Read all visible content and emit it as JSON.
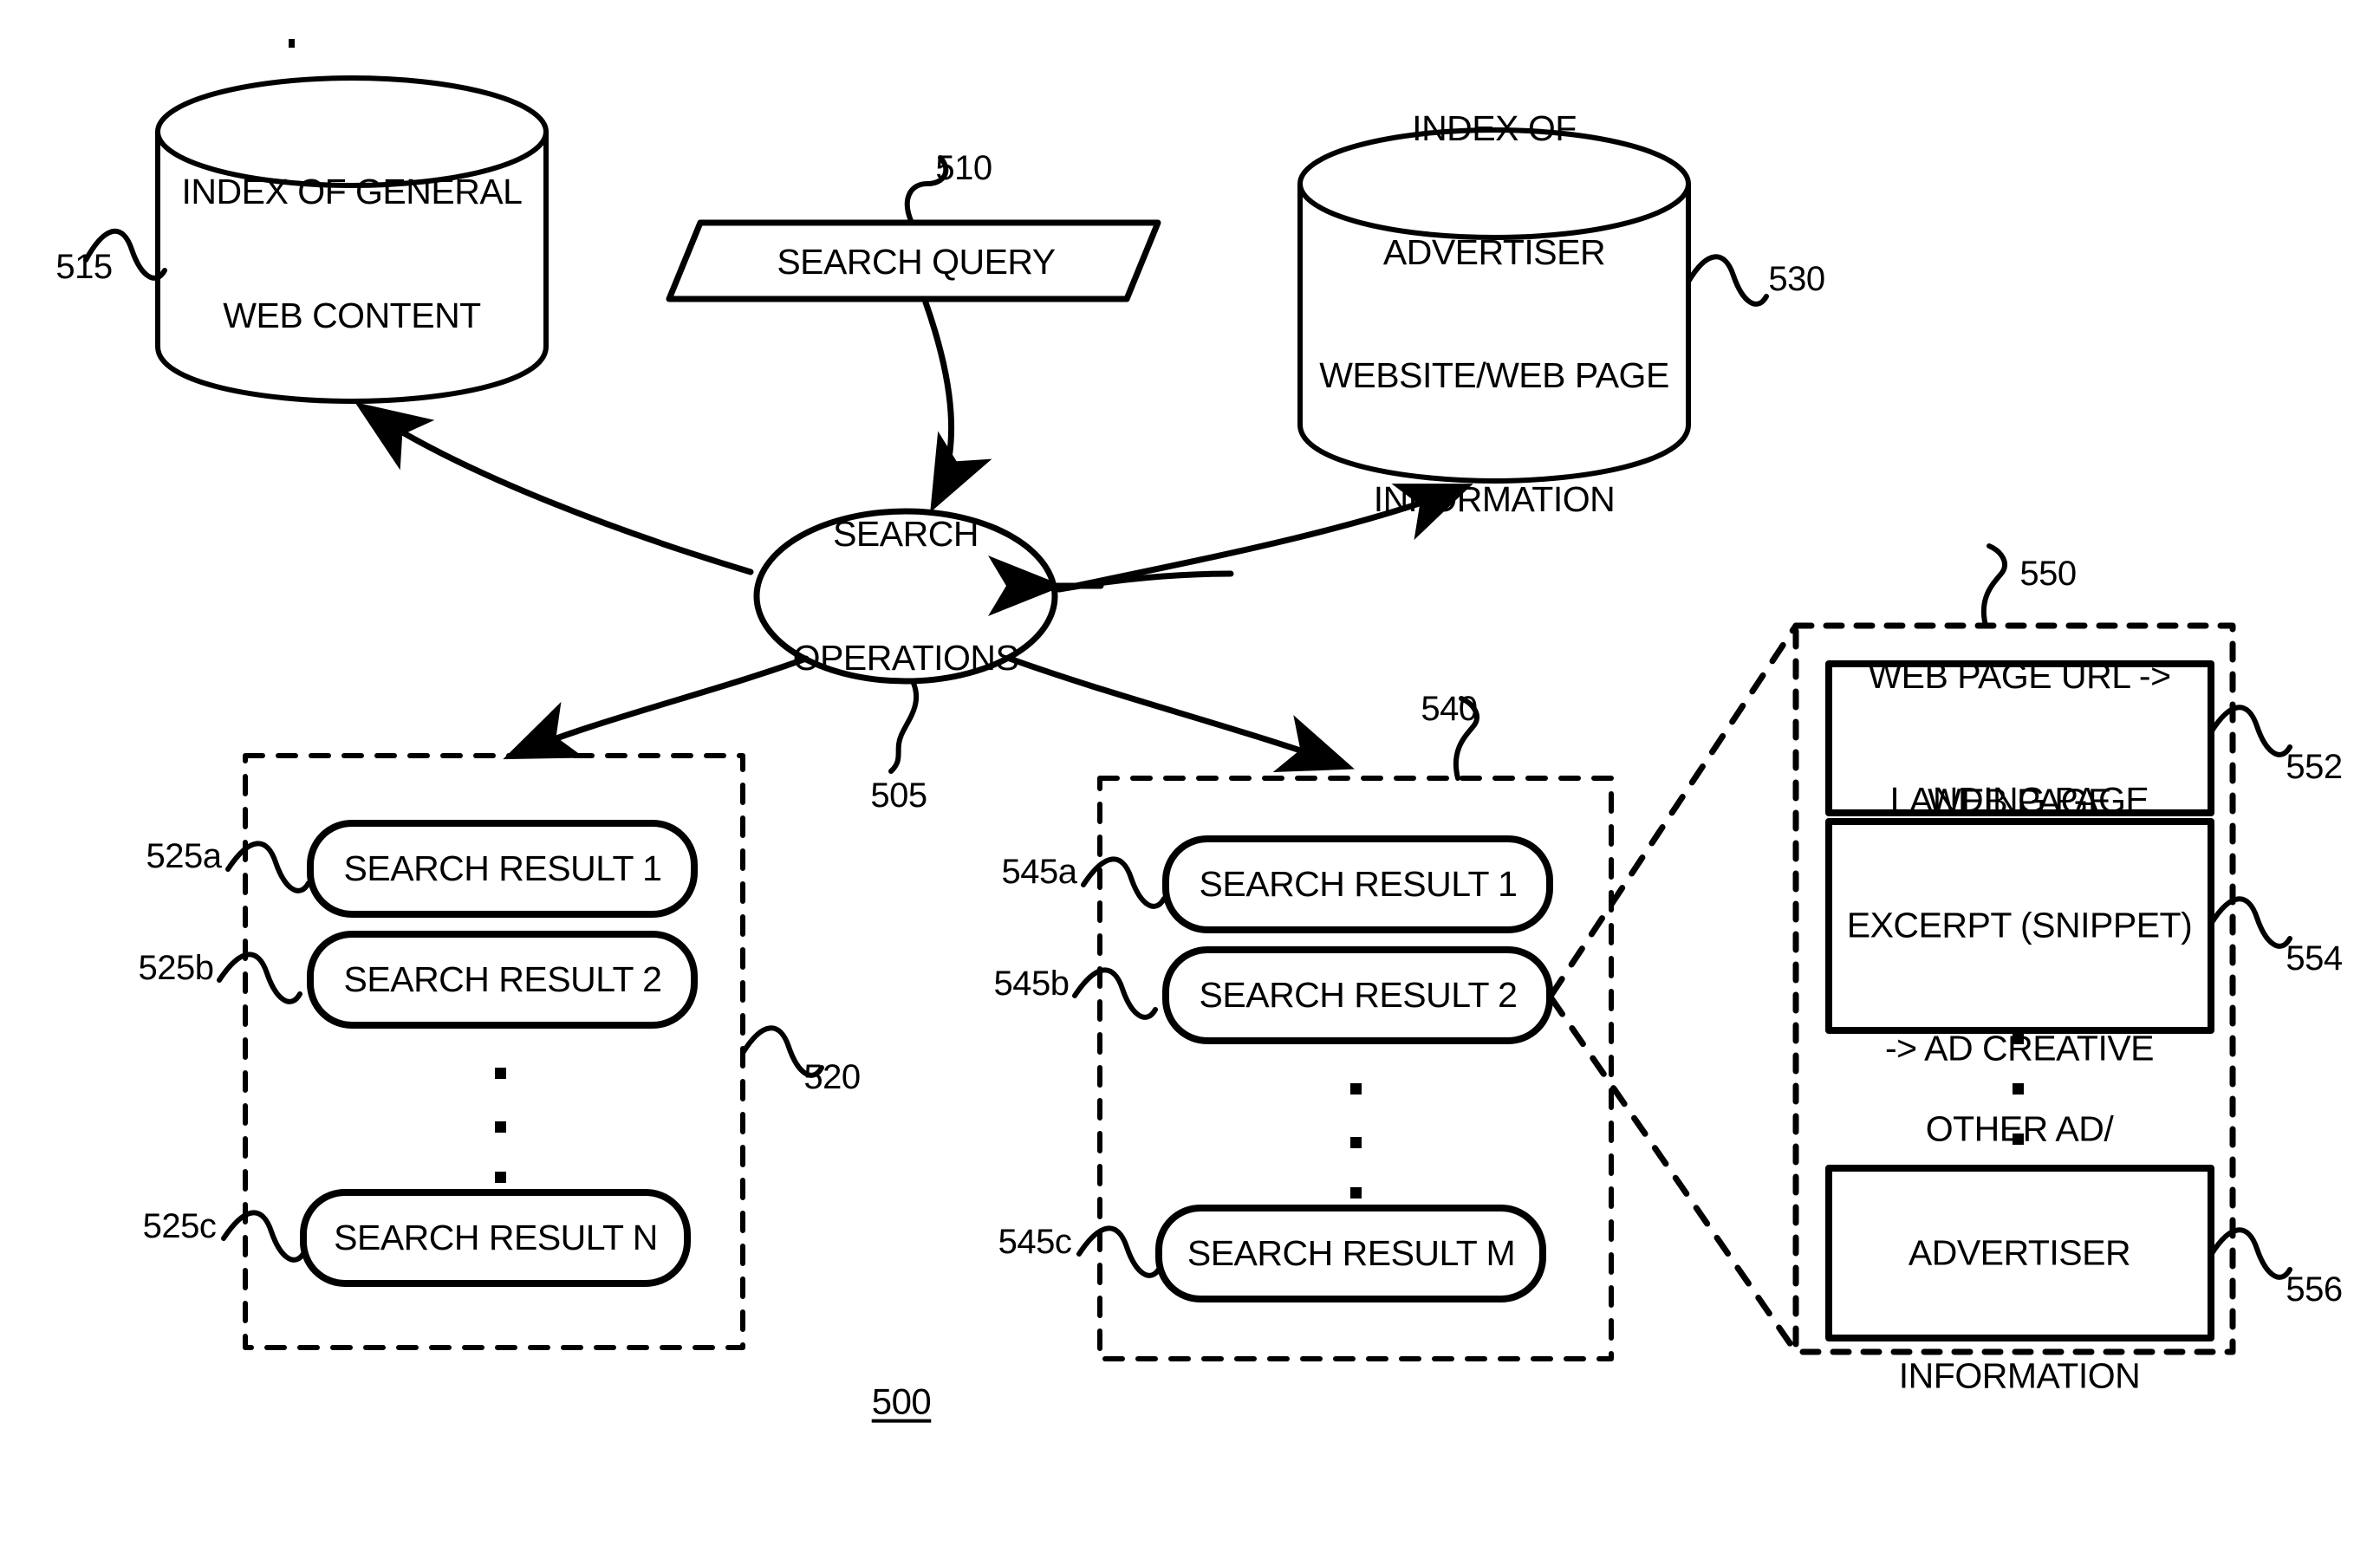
{
  "figure": {
    "number": "500",
    "title_visible": false
  },
  "nodes": {
    "index_general": {
      "label_line1": "INDEX OF GENERAL",
      "label_line2": "WEB CONTENT",
      "ref": "515",
      "shape": "cylinder"
    },
    "search_query": {
      "label": "SEARCH QUERY",
      "ref": "510",
      "shape": "parallelogram"
    },
    "index_advertiser": {
      "label_line1": "INDEX OF",
      "label_line2": "ADVERTISER",
      "label_line3": "WEBSITE/WEB PAGE",
      "label_line4": "INFORMATION",
      "ref": "530",
      "shape": "cylinder"
    },
    "search_operations": {
      "label_line1": "SEARCH",
      "label_line2": "OPERATIONS",
      "ref": "505",
      "shape": "ellipse"
    },
    "results_group_left": {
      "ref": "520",
      "shape": "dashed-container",
      "items": [
        {
          "label": "SEARCH RESULT 1",
          "ref": "525a"
        },
        {
          "label": "SEARCH RESULT 2",
          "ref": "525b"
        },
        {
          "label": "SEARCH RESULT N",
          "ref": "525c"
        }
      ],
      "ellipsis": "vertical-dots"
    },
    "results_group_right": {
      "ref": "540",
      "shape": "dashed-container",
      "items": [
        {
          "label": "SEARCH RESULT 1",
          "ref": "545a"
        },
        {
          "label": "SEARCH RESULT 2",
          "ref": "545b"
        },
        {
          "label": "SEARCH RESULT M",
          "ref": "545c"
        }
      ],
      "ellipsis": "vertical-dots"
    },
    "detail_callout": {
      "ref": "550",
      "shape": "dashed-container",
      "items": [
        {
          "label_line1": "WEB PAGE URL ->",
          "label_line2": "LANDING PAGE",
          "ref": "552"
        },
        {
          "label_line1": "WEB PAGE",
          "label_line2": "EXCERPT (SNIPPET)",
          "label_line3": "-> AD CREATIVE",
          "ref": "554"
        },
        {
          "label_line1": "OTHER AD/",
          "label_line2": "ADVERTISER",
          "label_line3": "INFORMATION",
          "ref": "556"
        }
      ],
      "ellipsis": "vertical-dots"
    }
  },
  "colors": {
    "stroke": "#000000",
    "background": "#ffffff"
  }
}
